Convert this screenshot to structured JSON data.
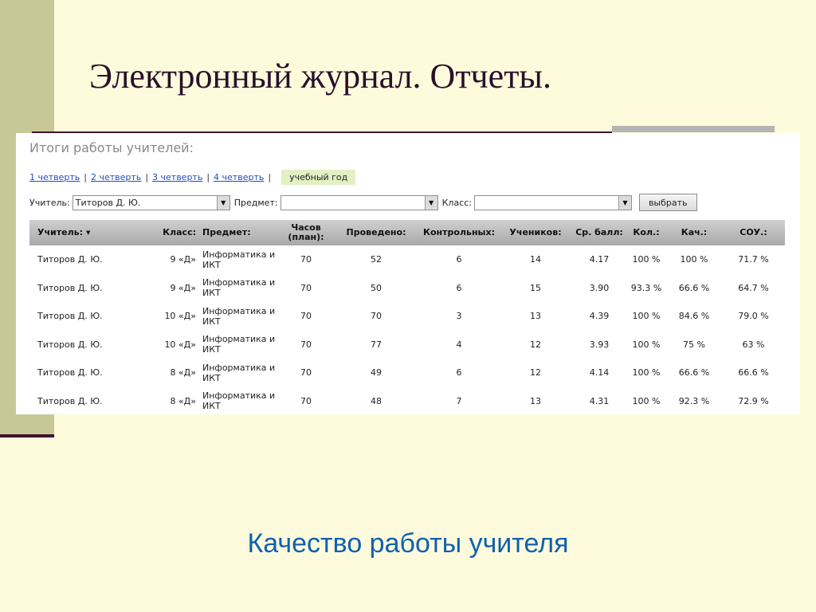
{
  "slide": {
    "title": "Электронный журнал. Отчеты.",
    "subtitle": "Качество работы учителя"
  },
  "app": {
    "heading": "Итоги работы учителей:",
    "periods": [
      "1 четверть",
      "2 четверть",
      "3 четверть",
      "4 четверть"
    ],
    "period_separator": "|",
    "active_period": "учебный год",
    "filters": {
      "teacher_label": "Учитель:",
      "teacher_value": "Титоров Д. Ю.",
      "subject_label": "Предмет:",
      "subject_value": "",
      "class_label": "Класс:",
      "class_value": "",
      "submit_label": "выбрать"
    },
    "table": {
      "columns": [
        "Учитель:",
        "Класс:",
        "Предмет:",
        "Часов (план):",
        "Проведено:",
        "Контрольных:",
        "Учеников:",
        "Ср. балл:",
        "Кол.:",
        "Кач.:",
        "СОУ.:"
      ],
      "rows": [
        [
          "Титоров Д. Ю.",
          "9 «Д»",
          "Информатика и ИКТ",
          "70",
          "52",
          "6",
          "14",
          "4.17",
          "100 %",
          "100 %",
          "71.7 %"
        ],
        [
          "Титоров Д. Ю.",
          "9 «Д»",
          "Информатика и ИКТ",
          "70",
          "50",
          "6",
          "15",
          "3.90",
          "93.3 %",
          "66.6 %",
          "64.7 %"
        ],
        [
          "Титоров Д. Ю.",
          "10 «Д»",
          "Информатика и ИКТ",
          "70",
          "70",
          "3",
          "13",
          "4.39",
          "100 %",
          "84.6 %",
          "79.0 %"
        ],
        [
          "Титоров Д. Ю.",
          "10 «Д»",
          "Информатика и ИКТ",
          "70",
          "77",
          "4",
          "12",
          "3.93",
          "100 %",
          "75 %",
          "63 %"
        ],
        [
          "Титоров Д. Ю.",
          "8 «Д»",
          "Информатика и ИКТ",
          "70",
          "49",
          "6",
          "12",
          "4.14",
          "100 %",
          "66.6 %",
          "66.6 %"
        ],
        [
          "Титоров Д. Ю.",
          "8 «Д»",
          "Информатика и ИКТ",
          "70",
          "48",
          "7",
          "13",
          "4.31",
          "100 %",
          "92.3 %",
          "72.9 %"
        ]
      ]
    }
  },
  "icons": {
    "sort": "sort-down-icon",
    "dropdown": "chevron-down-icon"
  },
  "colors": {
    "slide_background": "#fdfbdc",
    "accent_bar": "#c7c896",
    "rule_line": "#3f1230",
    "subtitle": "#1060b0",
    "link": "#1f4fbf",
    "active_tab": "#e2f0c4"
  }
}
